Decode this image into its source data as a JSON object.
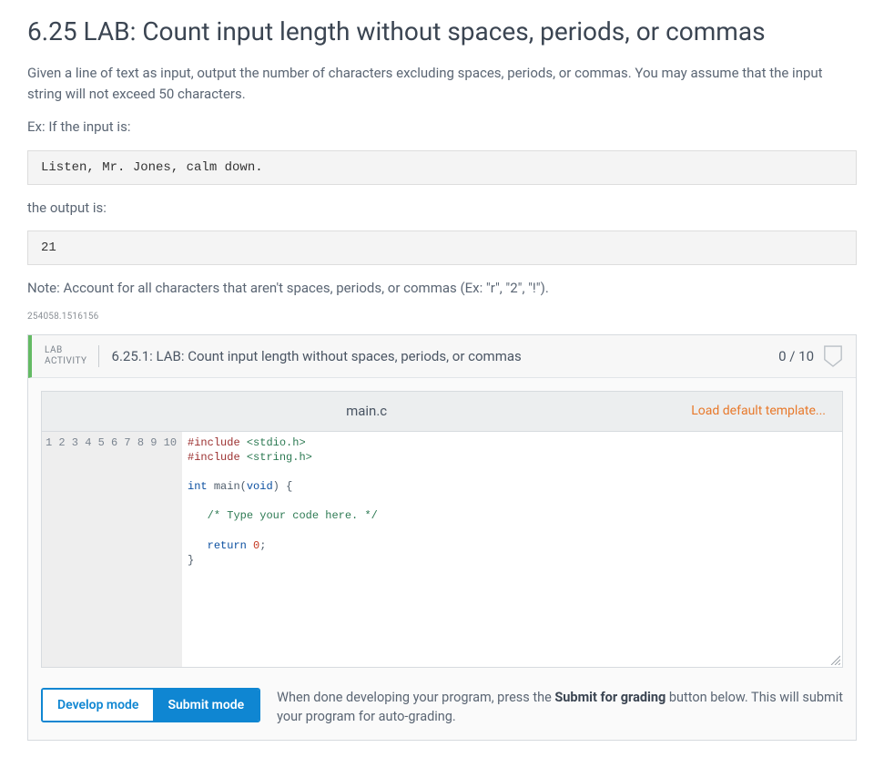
{
  "title": "6.25 LAB: Count input length without spaces, periods, or commas",
  "intro": "Given a line of text as input, output the number of characters excluding spaces, periods, or commas. You may assume that the input string will not exceed 50 characters.",
  "ex_label": "Ex: If the input is:",
  "input_example": "Listen, Mr. Jones, calm down.",
  "output_label": "the output is:",
  "output_example": "21",
  "note": "Note: Account for all characters that aren't spaces, periods, or commas (Ex: \"r\", \"2\", \"!\").",
  "page_id": "254058.1516156",
  "lab": {
    "tag_line1": "LAB",
    "tag_line2": "ACTIVITY",
    "title": "6.25.1: LAB: Count input length without spaces, periods, or commas",
    "score": "0 / 10"
  },
  "editor": {
    "filename": "main.c",
    "load_link": "Load default template...",
    "line_numbers": "1\n2\n3\n4\n5\n6\n7\n8\n9\n10",
    "code": {
      "l1a": "#include",
      "l1b": " <stdio.h>",
      "l2a": "#include",
      "l2b": " <string.h>",
      "l4a": "int",
      "l4b": " main(",
      "l4c": "void",
      "l4d": ") {",
      "l6": "   /* Type your code here. */",
      "l8a": "   return ",
      "l8b": "0",
      "l8c": ";",
      "l9": "}"
    }
  },
  "modes": {
    "develop": "Develop mode",
    "submit": "Submit mode",
    "desc_pre": "When done developing your program, press the ",
    "desc_bold": "Submit for grading",
    "desc_post": " button below. This will submit your program for auto-grading."
  }
}
